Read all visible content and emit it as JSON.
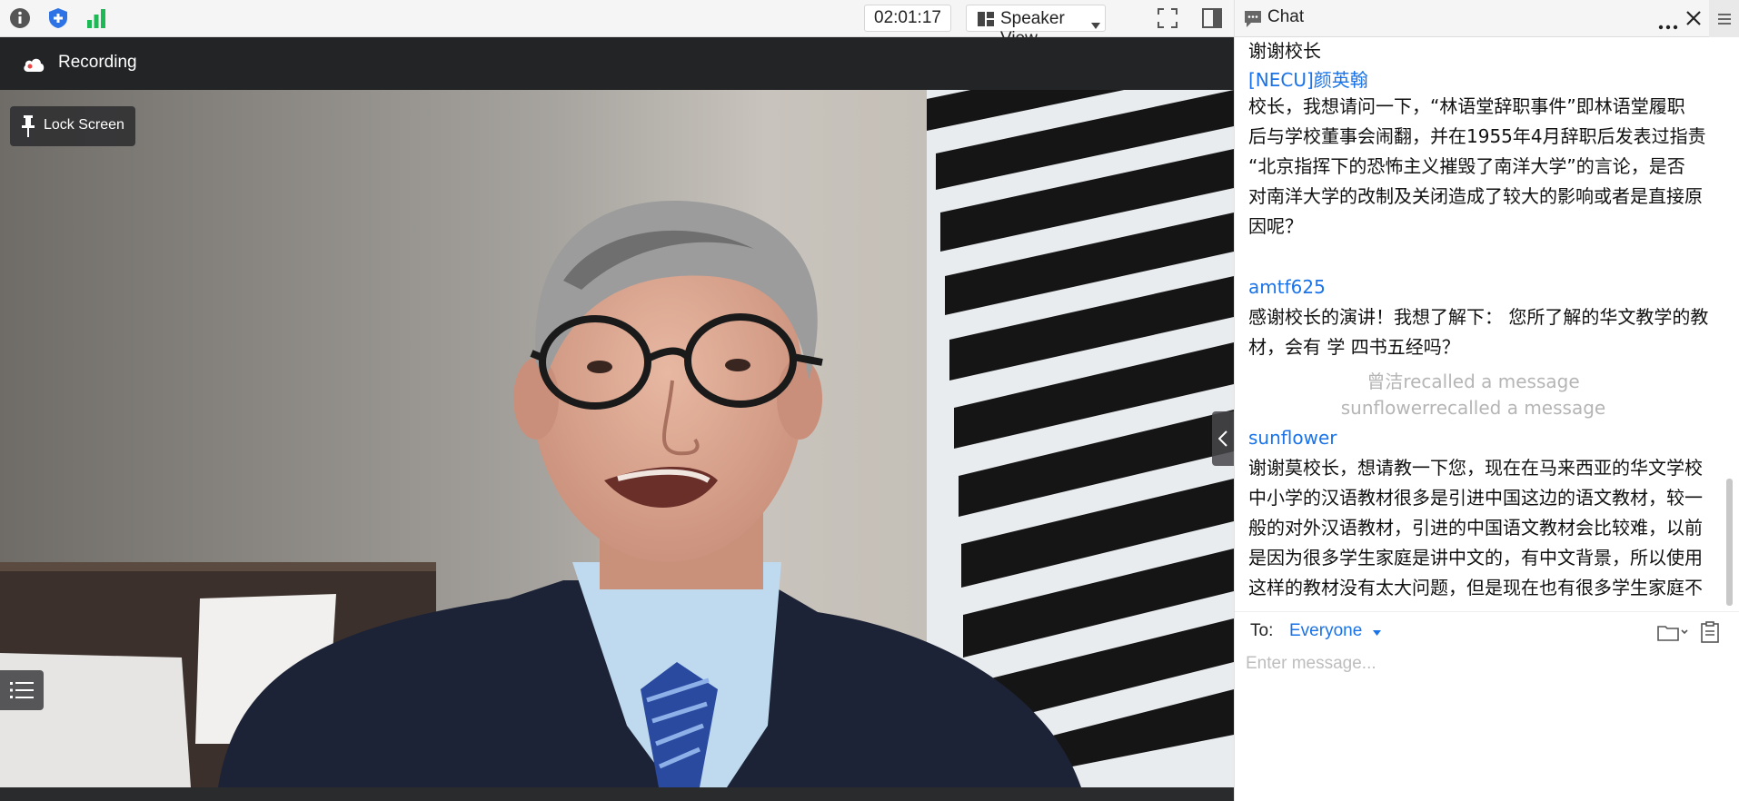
{
  "toolbar": {
    "icons": [
      "info-icon",
      "shield-icon",
      "signal-bars-icon"
    ],
    "timer": "02:01:17",
    "view_label": "Speaker View",
    "fullscreen_icon": "fullscreen-icon",
    "panel_icon": "side-panel-icon"
  },
  "recording": {
    "label": "Recording",
    "icon": "cloud-icon"
  },
  "video": {
    "lock_screen_label": "Lock Screen",
    "lock_icon": "pin-icon",
    "participants_icon": "list-icon",
    "collapse_icon": "chevron-left-icon"
  },
  "chat": {
    "title": "Chat",
    "header_icons": [
      "chat-bubble-icon",
      "more-icon",
      "close-icon",
      "menu-icon"
    ],
    "messages": [
      {
        "text": "谢谢校长"
      },
      {
        "sender": "[NECU]颜英翰",
        "lines": [
          "校长，我想请问一下，“林语堂辞职事件”即林语堂履职",
          "后与学校董事会闹翻，并在1955年4月辞职后发表过指责",
          "“北京指挥下的恐怖主义摧毁了南洋大学”的言论，是否",
          "对南洋大学的改制及关闭造成了较大的影响或者是直接原",
          "因呢？"
        ]
      },
      {
        "sender": "amtf625",
        "lines": [
          "感谢校长的演讲！我想了解下： 您所了解的华文教学的教",
          "材，会有 学 四书五经吗？"
        ]
      },
      {
        "recall": "曾洁recalled a message"
      },
      {
        "recall": "sunflowerrecalled a message"
      },
      {
        "sender": "sunflower",
        "lines": [
          "谢谢莫校长，想请教一下您，现在在马来西亚的华文学校",
          "中小学的汉语教材很多是引进中国这边的语文教材，较一",
          "般的对外汉语教材，引进的中国语文教材会比较难，以前",
          "是因为很多学生家庭是讲中文的，有中文背景，所以使用",
          "这样的教材没有太大问题，但是现在也有很多学生家庭不"
        ]
      }
    ],
    "compose": {
      "to_label": "To:",
      "recipient": "Everyone",
      "placeholder": "Enter message...",
      "icons": [
        "folder-icon",
        "clipboard-icon"
      ]
    }
  }
}
